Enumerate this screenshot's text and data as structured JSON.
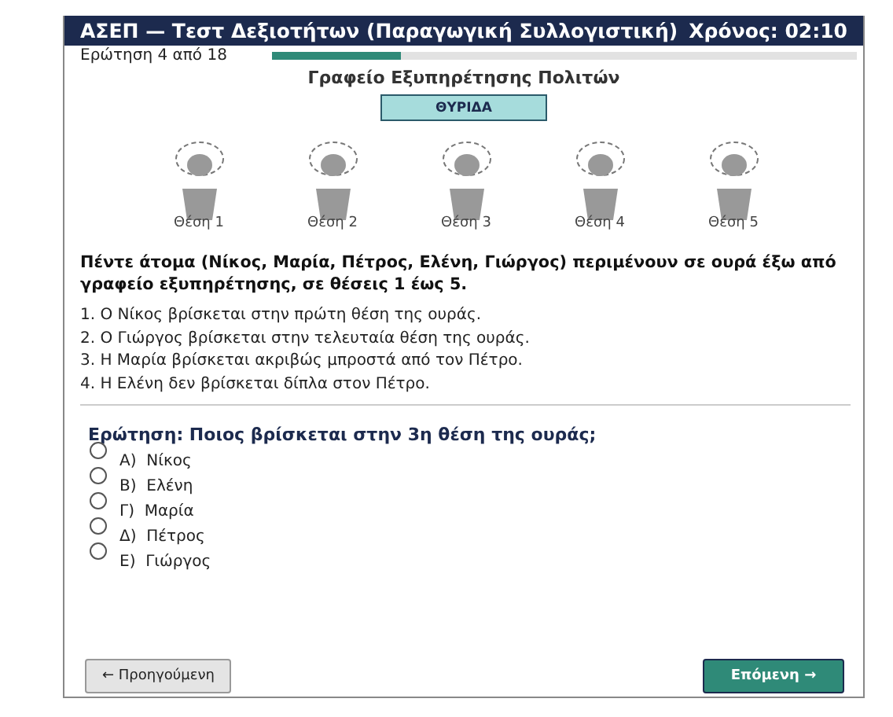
{
  "header": {
    "title": "ΑΣΕΠ — Τεστ Δεξιοτήτων (Παραγωγική Συλλογιστική)",
    "timer": "Χρόνος: 02:10"
  },
  "progress": {
    "label": "Ερώτηση 4 από 18",
    "level": 0.22
  },
  "scene": {
    "title": "Γραφείο Εξυπηρέτησης Πολιτών",
    "window_label": "ΘΥΡΙΔΑ",
    "positions": [
      {
        "label": "Θέση 1"
      },
      {
        "label": "Θέση 2"
      },
      {
        "label": "Θέση 3"
      },
      {
        "label": "Θέση 4"
      },
      {
        "label": "Θέση 5"
      }
    ]
  },
  "intro": "Πέντε άτομα (Νίκος, Μαρία, Πέτρος, Ελένη, Γιώργος) περιμένουν σε ουρά έξω από γραφείο εξυπηρέτησης, σε θέσεις 1 έως 5.",
  "clues": [
    "1. Ο Νίκος βρίσκεται στην πρώτη θέση της ουράς.",
    "2. Ο Γιώργος βρίσκεται στην τελευταία θέση της ουράς.",
    "3. Η Μαρία βρίσκεται ακριβώς μπροστά από τον Πέτρο.",
    "4. Η Ελένη δεν βρίσκεται δίπλα στον Πέτρο."
  ],
  "question": "Ερώτηση: Ποιος βρίσκεται στην 3η θέση της ουράς;",
  "options": [
    {
      "label": "Α)  Νίκος",
      "selected": false
    },
    {
      "label": "Β)  Ελένη",
      "selected": false
    },
    {
      "label": "Γ)  Μαρία",
      "selected": false
    },
    {
      "label": "Δ)  Πέτρος",
      "selected": false
    },
    {
      "label": "Ε)  Γιώργος",
      "selected": false
    }
  ],
  "buttons": {
    "previous": "← Προηγούμενη",
    "next": "Επόμενη →"
  }
}
